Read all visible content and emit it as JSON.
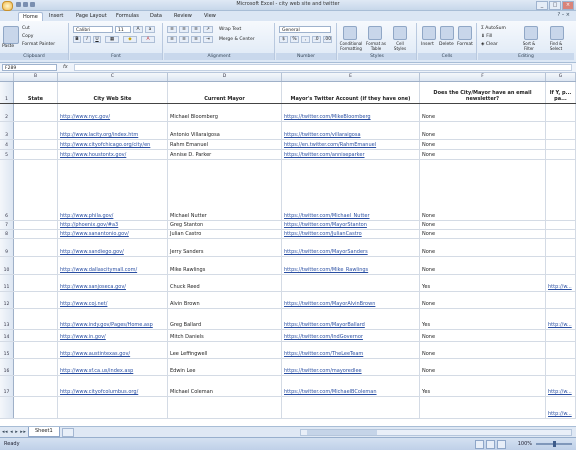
{
  "window": {
    "title": "Microsoft Excel - city web site and twitter"
  },
  "ribbon_tabs": [
    "Home",
    "Insert",
    "Page Layout",
    "Formulas",
    "Data",
    "Review",
    "View"
  ],
  "ribbon": {
    "clipboard": {
      "paste": "Paste",
      "cut": "Cut",
      "copy": "Copy",
      "format_painter": "Format Painter",
      "label": "Clipboard"
    },
    "font": {
      "name": "Calibri",
      "size": "11",
      "label": "Font"
    },
    "alignment": {
      "wrap": "Wrap Text",
      "merge": "Merge & Center",
      "label": "Alignment"
    },
    "number": {
      "format": "General",
      "label": "Number"
    },
    "styles": {
      "conditional": "Conditional Formatting",
      "format_table": "Format as Table",
      "cell_styles": "Cell Styles",
      "label": "Styles"
    },
    "cells": {
      "insert": "Insert",
      "delete": "Delete",
      "format": "Format",
      "label": "Cells"
    },
    "editing": {
      "autosum": "AutoSum",
      "fill": "Fill",
      "clear": "Clear",
      "sort": "Sort & Filter",
      "find": "Find & Select",
      "label": "Editing"
    }
  },
  "formula_bar": {
    "name_box": "F289",
    "fx": "fx",
    "content": ""
  },
  "columns": [
    "A",
    "B",
    "C",
    "D",
    "E",
    "F",
    "G"
  ],
  "headers": {
    "state": "State",
    "website": "City Web Site",
    "mayor": "Current Mayor",
    "twitter": "Mayor's Twitter Account (if they have one)",
    "newsletter": "Does the City/Mayor have an email newsletter?",
    "extra": "If Y, p... pa..."
  },
  "rows": [
    {
      "num": "1",
      "website": "",
      "mayor": "",
      "twitter": "",
      "newsletter": "",
      "extra": ""
    },
    {
      "num": "2",
      "website": "http://www.nyc.gov/",
      "mayor": "Michael Bloomberg",
      "twitter": "https://twitter.com/MikeBloomberg",
      "newsletter": "None",
      "extra": ""
    },
    {
      "num": "3",
      "website": "http://www.lacity.org/index.htm",
      "mayor": "Antonio Villaraigosa",
      "twitter": "https://twitter.com/villaraigosa",
      "newsletter": "None",
      "extra": ""
    },
    {
      "num": "4",
      "website": "http://www.cityofchicago.org/city/en",
      "mayor": "Rahm Emanuel",
      "twitter": "https://en.twitter.com/RahmEmanuel",
      "newsletter": "None",
      "extra": ""
    },
    {
      "num": "5",
      "website": "http://www.houstontx.gov/",
      "mayor": "Annise D. Parker",
      "twitter": "https://twitter.com/anniseparker",
      "newsletter": "None",
      "extra": ""
    },
    {
      "num": "6",
      "website": "http://www.phila.gov/",
      "mayor": "Michael Nutter",
      "twitter": "https://twitter.com/Michael_Nutter",
      "newsletter": "None",
      "extra": ""
    },
    {
      "num": "7",
      "website": "http://phoenix.gov/#a3",
      "mayor": "Greg Stanton",
      "twitter": "https://twitter.com/MayorStanton",
      "newsletter": "None",
      "extra": ""
    },
    {
      "num": "8",
      "website": "http://www.sanantonio.gov/",
      "mayor": "Julian Castro",
      "twitter": "https://twitter.com/JulianCastro",
      "newsletter": "None",
      "extra": ""
    },
    {
      "num": "9",
      "website": "http://www.sandiego.gov/",
      "mayor": "Jerry Sanders",
      "twitter": "https://twitter.com/MayorSanders",
      "newsletter": "None",
      "extra": ""
    },
    {
      "num": "10",
      "website": "http://www.dallascitymall.com/",
      "mayor": "Mike Rawlings",
      "twitter": "https://twitter.com/Mike_Rawlings",
      "newsletter": "None",
      "extra": ""
    },
    {
      "num": "11",
      "website": "http://www.sanjoseca.gov/",
      "mayor": "Chuck Reed",
      "twitter": "",
      "newsletter": "Yes",
      "extra": "http://w..."
    },
    {
      "num": "12",
      "website": "http://www.coj.net/",
      "mayor": "Alvin Brown",
      "twitter": "https://twitter.com/MayorAlvinBrown",
      "newsletter": "None",
      "extra": ""
    },
    {
      "num": "13",
      "website": "http://www.indy.gov/Pages/Home.asp",
      "mayor": "Greg Ballard",
      "twitter": "https://twitter.com/MayorBallard",
      "newsletter": "Yes",
      "extra": "http://w..."
    },
    {
      "num": "14",
      "website": "http://www.in.gov/",
      "mayor": "Mitch Daniels",
      "twitter": "https://twitter.com/IndGovernor",
      "newsletter": "None",
      "extra": ""
    },
    {
      "num": "15",
      "website": "http://www.austintexas.gov/",
      "mayor": "Lee Leffingwell",
      "twitter": "https://twitter.com/TheLeeTeam",
      "newsletter": "None",
      "extra": ""
    },
    {
      "num": "16",
      "website": "http://www.sf.ca.us/index.asp",
      "mayor": "Edwin Lee",
      "twitter": "https://twitter.com/mayoredlee",
      "newsletter": "None",
      "extra": ""
    },
    {
      "num": "17",
      "website": "http://www.cityofcolumbus.org/",
      "mayor": "Michael Coleman",
      "twitter": "https://twitter.com/MichaelBColeman",
      "newsletter": "Yes",
      "extra": "http://w..."
    },
    {
      "num": "",
      "website": "",
      "mayor": "",
      "twitter": "",
      "newsletter": "",
      "extra": "http://w..."
    }
  ],
  "sheet_tabs": [
    "Sheet1"
  ],
  "status": {
    "ready": "Ready",
    "zoom": "100%"
  }
}
